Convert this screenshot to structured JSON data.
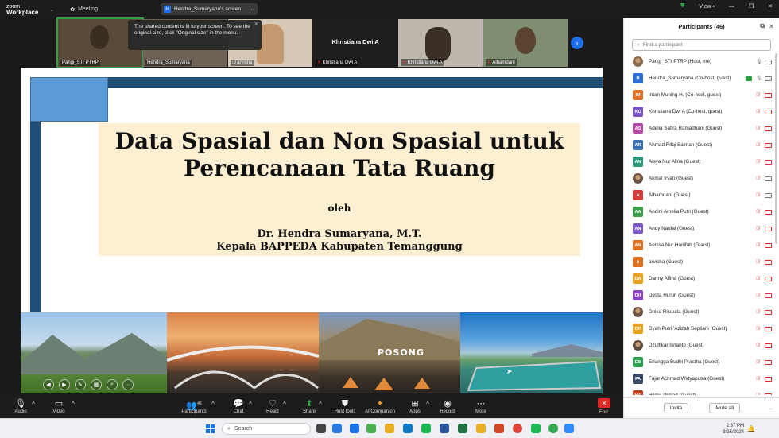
{
  "app": {
    "brand_line1": "zoom",
    "brand_line2": "Workplace",
    "meeting_label": "Meeting",
    "screen_label": "Hendra_Sumaryana's screen"
  },
  "topright": {
    "view_label": "View"
  },
  "tooltip": "The shared content is fit to your screen. To see the original size, click \"Original size\" in the menu.",
  "videos": [
    {
      "name": "Pangi_STr PTRP",
      "color": "#5b4a3a"
    },
    {
      "name": "Hendra_Sumaryana",
      "color": "#6d6255"
    },
    {
      "name": "arvisha",
      "color": "#b79a85"
    },
    {
      "name": "Khristiana Dwi A",
      "color": "#1e1e1e",
      "bigname": "Khristiana Dwi A"
    },
    {
      "name": "Khristiana Dwi A",
      "color": "#8f8b86"
    },
    {
      "name": "Alhamdani",
      "color": "#6b7a62"
    }
  ],
  "slide": {
    "title_line1": "Data Spasial dan Non Spasial untuk",
    "title_line2": "Perencanaan Tata Ruang",
    "oleh": "oleh",
    "author": "Dr. Hendra Sumaryana, M.T.",
    "position": "Kepala BAPPEDA Kabupaten Temanggung",
    "photo_text": "POSONG"
  },
  "toolbar": {
    "audio": "Audio",
    "video": "Video",
    "participants": "Participants",
    "participants_count": "46",
    "chat": "Chat",
    "react": "React",
    "share": "Share",
    "host_tools": "Host tools",
    "ai_companion": "AI Companion",
    "apps": "Apps",
    "record": "Record",
    "more": "More",
    "end": "End"
  },
  "panel": {
    "title": "Participants (46)",
    "search_placeholder": "Find a participant",
    "invite": "Invite",
    "mute_all": "Mute all",
    "more": "...",
    "participants": [
      {
        "initials": "",
        "name": "Pangi_STr PTRP (Host, me)",
        "color": "#8a6a4a",
        "photo": true,
        "muted": false
      },
      {
        "initials": "H",
        "name": "Hendra_Sumaryana (Co-host, guest)",
        "color": "#2f6fd8",
        "muted": false
      },
      {
        "initials": "IM",
        "name": "Intan Muning H. (Co-host, guest)",
        "color": "#e07020",
        "muted": true
      },
      {
        "initials": "KD",
        "name": "Khristiana Dwi A (Co-host, guest)",
        "color": "#7a55c4",
        "muted": true
      },
      {
        "initials": "AS",
        "name": "Adelia Safira Ramadhani (Guest)",
        "color": "#b04aa0",
        "muted": true
      },
      {
        "initials": "AR",
        "name": "Ahmad Rifqi Salman (Guest)",
        "color": "#3a6fb0",
        "muted": true
      },
      {
        "initials": "AN",
        "name": "Aisya Nur Alina (Guest)",
        "color": "#2a9a7a",
        "muted": true
      },
      {
        "initials": "",
        "name": "Akmal Irvan (Guest)",
        "color": "#6a5040",
        "photo": true,
        "muted": true
      },
      {
        "initials": "A",
        "name": "Alhamdani (Guest)",
        "color": "#d83a3a",
        "muted": true
      },
      {
        "initials": "AA",
        "name": "Andini Amelia Putri (Guest)",
        "color": "#3aa04a",
        "muted": true
      },
      {
        "initials": "AN",
        "name": "Andy Naufal (Guest)",
        "color": "#7a55c4",
        "muted": true
      },
      {
        "initials": "AN",
        "name": "Annisa Nur Hanifah (Guest)",
        "color": "#e07020",
        "muted": true
      },
      {
        "initials": "A",
        "name": "arvisha (Guest)",
        "color": "#e07020",
        "muted": true
      },
      {
        "initials": "DA",
        "name": "Danny Alfina (Guest)",
        "color": "#e8a020",
        "muted": true
      },
      {
        "initials": "DH",
        "name": "Desta Hurun (Guest)",
        "color": "#8a45c0",
        "muted": true
      },
      {
        "initials": "",
        "name": "Dhika Risquita (Guest)",
        "color": "#6a5040",
        "photo": true,
        "muted": true
      },
      {
        "initials": "DP",
        "name": "Dyah Putri 'Azizah Septiani (Guest)",
        "color": "#e8a020",
        "muted": true
      },
      {
        "initials": "",
        "name": "Dzulfikar Isnanto (Guest)",
        "color": "#5a4a3a",
        "photo": true,
        "muted": true
      },
      {
        "initials": "EB",
        "name": "Erlangga Budhi Prastha (Guest)",
        "color": "#2aa050",
        "muted": true
      },
      {
        "initials": "FA",
        "name": "Fajar Achmad Widyaputra (Guest)",
        "color": "#3a4a6a",
        "muted": true
      },
      {
        "initials": "HA",
        "name": "Hilmy ahmad (Guest)",
        "color": "#c04020",
        "muted": true
      }
    ]
  },
  "taskbar": {
    "search": "Search",
    "time": "2:37 PM",
    "date": "9/25/2024"
  }
}
